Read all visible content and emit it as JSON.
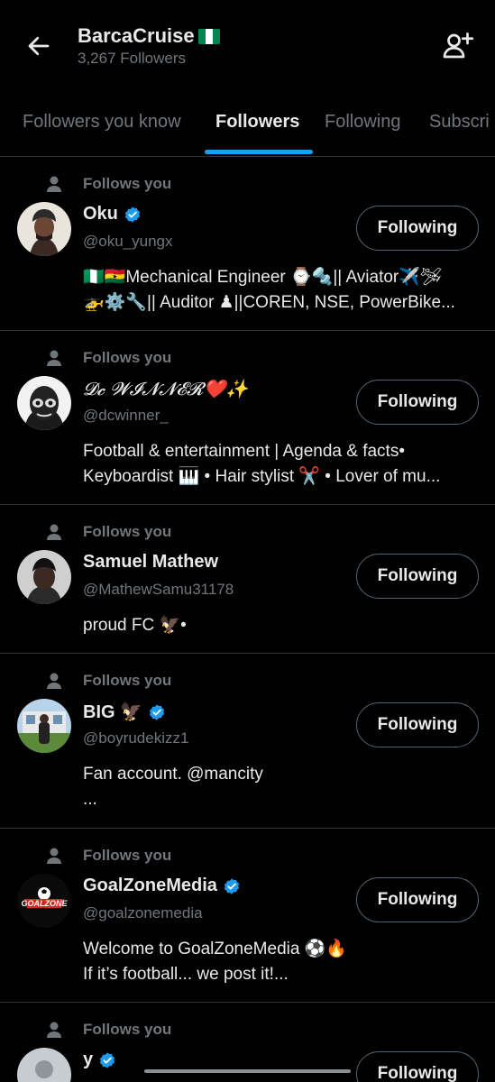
{
  "header": {
    "title": "BarcaCruise",
    "subtitle": "3,267 Followers",
    "flag_colors": [
      "#008751",
      "#ffffff",
      "#008751"
    ]
  },
  "tabs": [
    {
      "label": "Followers you know",
      "active": false
    },
    {
      "label": "Followers",
      "active": true
    },
    {
      "label": "Following",
      "active": false
    },
    {
      "label": "Subscri",
      "active": false
    }
  ],
  "colors": {
    "accent": "#1d9bf0",
    "muted": "#71767b",
    "text": "#e7e9ea",
    "background": "#000000"
  },
  "users": [
    {
      "follows_label": "Follows you",
      "name": "Oku",
      "verified": true,
      "handle": "@oku_yungx",
      "button": "Following",
      "bio": "🇳🇬🇬🇭Mechanical Engineer ⌚🔩|| Aviator✈️🛩\n🚁⚙️🔧|| Auditor ♟||COREN, NSE, PowerBike..."
    },
    {
      "follows_label": "Follows you",
      "name": "𝓓𝓬 𝓦𝓘𝓝𝓝𝓔𝓡❤️✨",
      "verified": false,
      "handle": "@dcwinner_",
      "button": "Following",
      "bio": "Football & entertainment | Agenda & facts•\nKeyboardist 🎹 • Hair stylist ✂️ • Lover of mu..."
    },
    {
      "follows_label": "Follows you",
      "name": "Samuel Mathew",
      "verified": false,
      "handle": "@MathewSamu31178",
      "button": "Following",
      "bio": "proud FC 🦅•"
    },
    {
      "follows_label": "Follows you",
      "name": "BIG 🦅",
      "verified": true,
      "handle": "@boyrudekizz1",
      "button": "Following",
      "bio": "Fan account. @mancity\n..."
    },
    {
      "follows_label": "Follows you",
      "name": "GoalZoneMedia",
      "verified": true,
      "handle": "@goalzonemedia",
      "button": "Following",
      "bio": "Welcome to GoalZoneMedia ⚽🔥\nIf it’s football... we post it!..."
    },
    {
      "follows_label": "Follows you",
      "name": "y",
      "verified": true,
      "handle": "",
      "button": "Following",
      "bio": ""
    }
  ]
}
